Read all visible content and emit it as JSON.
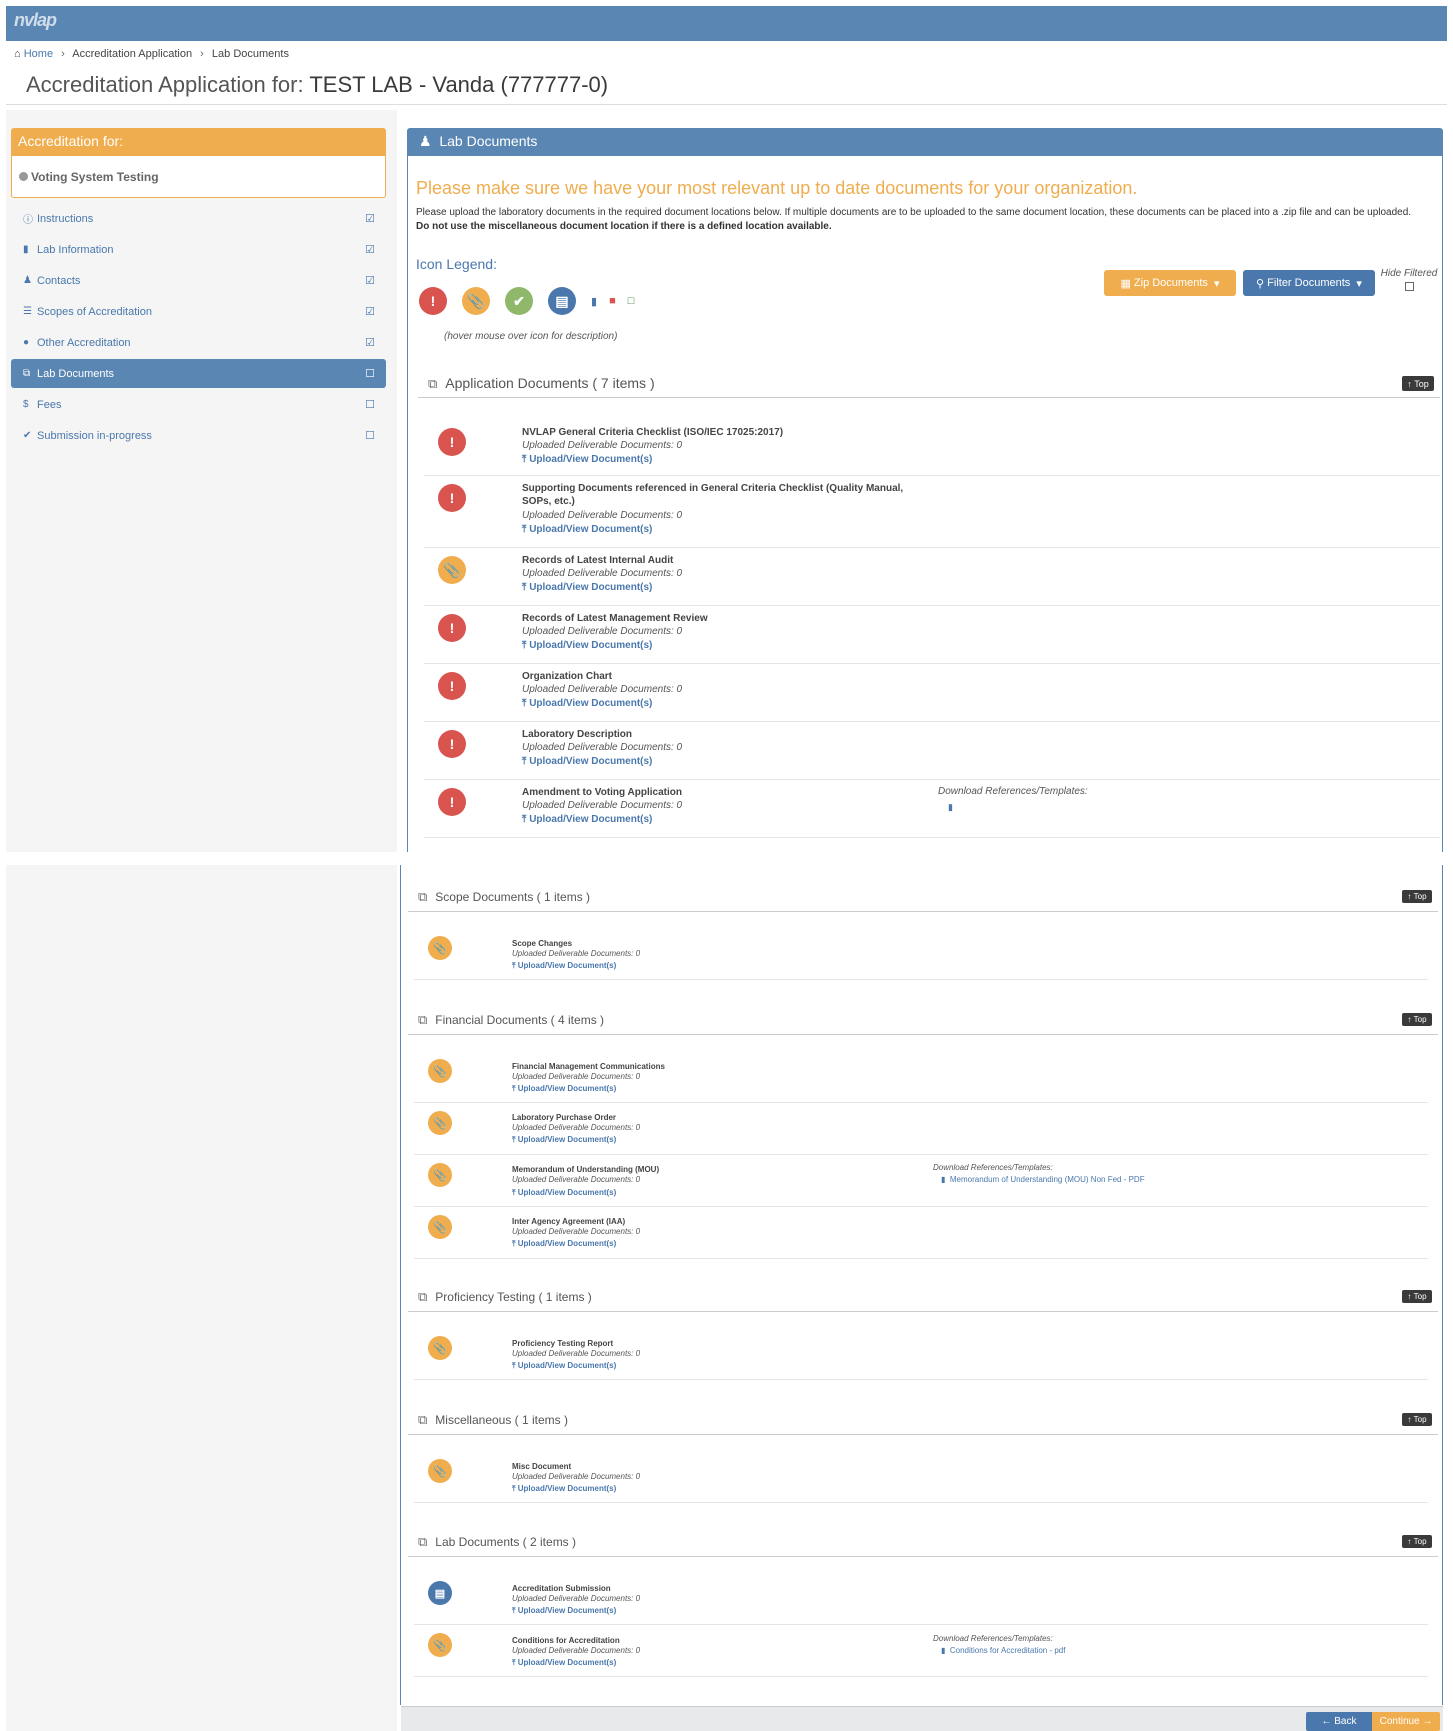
{
  "app": {
    "logo_text": "nvlap"
  },
  "breadcrumb": {
    "home": "Home",
    "app": "Accreditation Application",
    "current": "Lab Documents"
  },
  "page_title": {
    "prefix": "Accreditation Application for: ",
    "lab": "TEST LAB - Vanda (777777-0)"
  },
  "sidebar": {
    "accreditation_header": "Accreditation for:",
    "program": "Voting System Testing",
    "items": [
      {
        "label": "Instructions",
        "icon": "info-icon",
        "checked": true
      },
      {
        "label": "Lab Information",
        "icon": "building-icon",
        "checked": true
      },
      {
        "label": "Contacts",
        "icon": "user-icon",
        "checked": true
      },
      {
        "label": "Scopes of Accreditation",
        "icon": "list-icon",
        "checked": true
      },
      {
        "label": "Other Accreditation",
        "icon": "circle-icon",
        "checked": true
      },
      {
        "label": "Lab Documents",
        "icon": "copy-icon",
        "checked": false,
        "active": true
      },
      {
        "label": "Fees",
        "icon": "dollar-icon",
        "checked": false
      },
      {
        "label": "Submission in-progress",
        "icon": "check-icon",
        "checked": false
      }
    ]
  },
  "panel": {
    "title": "Lab Documents",
    "intro_title": "Please make sure we have your most relevant up to date documents for your organization.",
    "intro_text": "Please upload the laboratory documents in the required document locations below. If multiple documents are to be uploaded to the same document location, these documents can be placed into a .zip file and can be uploaded. ",
    "intro_bold": "Do not use the miscellaneous document location if there is a defined location available.",
    "legend_title": "Icon Legend:",
    "hover_note": "(hover mouse over icon for description)",
    "zip_button": "Zip Documents",
    "filter_button": "Filter Documents",
    "hide_filtered": "Hide Filtered"
  },
  "common": {
    "count_label": "Uploaded Deliverable Documents: 0",
    "upload_link": "Upload/View Document(s)",
    "ref_label": "Download References/Templates:",
    "top_button": "Top"
  },
  "sections": {
    "application": {
      "title": "Application Documents ( 7 items )"
    },
    "scope": {
      "title": "Scope Documents ( 1 items )"
    },
    "financial": {
      "title": "Financial Documents ( 4 items )"
    },
    "proficiency": {
      "title": "Proficiency Testing ( 1 items )"
    },
    "misc": {
      "title": "Miscellaneous ( 1 items )"
    },
    "lab": {
      "title": "Lab Documents ( 2 items )"
    }
  },
  "docs": {
    "a1": "NVLAP General Criteria Checklist (ISO/IEC 17025:2017)",
    "a2": "Supporting Documents referenced in General Criteria Checklist (Quality Manual, SOPs, etc.)",
    "a3": "Records of Latest Internal Audit",
    "a4": "Records of Latest Management Review",
    "a5": "Organization Chart",
    "a6": "Laboratory Description",
    "a7": "Amendment to Voting Application",
    "s1": "Scope Changes",
    "f1": "Financial Management Communications",
    "f2": "Laboratory Purchase Order",
    "f3": "Memorandum of Understanding (MOU)",
    "f3_ref": "Memorandum of Understanding (MOU) Non Fed - PDF",
    "f4": "Inter Agency Agreement (IAA)",
    "p1": "Proficiency Testing Report",
    "m1": "Misc Document",
    "l1": "Accreditation Submission",
    "l2": "Conditions for Accreditation",
    "l2_ref": "Conditions for Accreditation - pdf"
  },
  "footer": {
    "back": "Back",
    "continue": "Continue"
  },
  "colors": {
    "brand_blue": "#5a86b3",
    "accent_orange": "#f0ad4e",
    "danger_red": "#d9534f",
    "success_green": "#8fb86a"
  }
}
